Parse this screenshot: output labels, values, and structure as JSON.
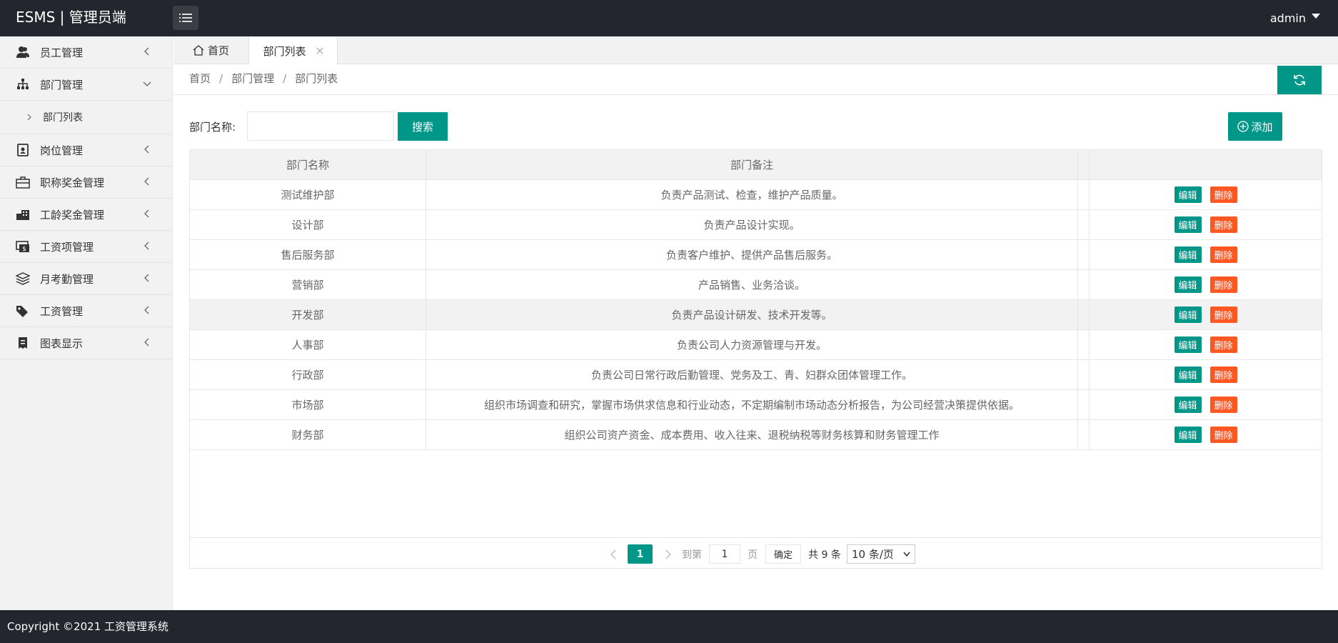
{
  "header": {
    "logo": "ESMS | 管理员端",
    "user": "admin"
  },
  "sidebar": {
    "items": [
      {
        "label": "员工管理",
        "icon": "users-icon",
        "expanded": false
      },
      {
        "label": "部门管理",
        "icon": "sitemap-icon",
        "expanded": true,
        "children": [
          {
            "label": "部门列表"
          }
        ]
      },
      {
        "label": "岗位管理",
        "icon": "badge-icon",
        "expanded": false
      },
      {
        "label": "职称奖金管理",
        "icon": "briefcase-icon",
        "expanded": false
      },
      {
        "label": "工龄奖金管理",
        "icon": "building-icon",
        "expanded": false
      },
      {
        "label": "工资项管理",
        "icon": "money-icon",
        "expanded": false
      },
      {
        "label": "月考勤管理",
        "icon": "layers-icon",
        "expanded": false
      },
      {
        "label": "工资管理",
        "icon": "tags-icon",
        "expanded": false
      },
      {
        "label": "图表显示",
        "icon": "receipt-icon",
        "expanded": false
      }
    ]
  },
  "tabs": {
    "home": "首页",
    "active": "部门列表"
  },
  "breadcrumb": [
    "首页",
    "部门管理",
    "部门列表"
  ],
  "search": {
    "label": "部门名称:",
    "value": "",
    "placeholder": "",
    "button": "搜索"
  },
  "add_button": "添加",
  "table": {
    "headers": [
      "部门名称",
      "部门备注",
      ""
    ],
    "rows": [
      {
        "name": "测试维护部",
        "note": "负责产品测试、检查，维护产品质量。"
      },
      {
        "name": "设计部",
        "note": "负责产品设计实现。"
      },
      {
        "name": "售后服务部",
        "note": "负责客户维护、提供产品售后服务。"
      },
      {
        "name": "营销部",
        "note": "产品销售、业务洽谈。"
      },
      {
        "name": "开发部",
        "note": "负责产品设计研发、技术开发等。"
      },
      {
        "name": "人事部",
        "note": "负责公司人力资源管理与开发。"
      },
      {
        "name": "行政部",
        "note": "负责公司日常行政后勤管理、党务及工、青、妇群众团体管理工作。"
      },
      {
        "name": "市场部",
        "note": "组织市场调查和研究，掌握市场供求信息和行业动态，不定期编制市场动态分析报告，为公司经营决策提供依据。"
      },
      {
        "name": "财务部",
        "note": "组织公司资产资金、成本费用、收入往来、退税纳税等财务核算和财务管理工作"
      }
    ],
    "edit_label": "编辑",
    "delete_label": "删除",
    "highlight_row": 4
  },
  "pager": {
    "current": "1",
    "goto_label": "到第",
    "goto_value": "1",
    "page_label": "页",
    "ok": "确定",
    "total": "共 9 条",
    "page_size": "10 条/页"
  },
  "footer": "Copyright ©2021 工资管理系统",
  "colors": {
    "header_bg": "#23262e",
    "primary": "#009688",
    "danger": "#ff5722",
    "sidebar_bg": "#f2f2f2"
  }
}
